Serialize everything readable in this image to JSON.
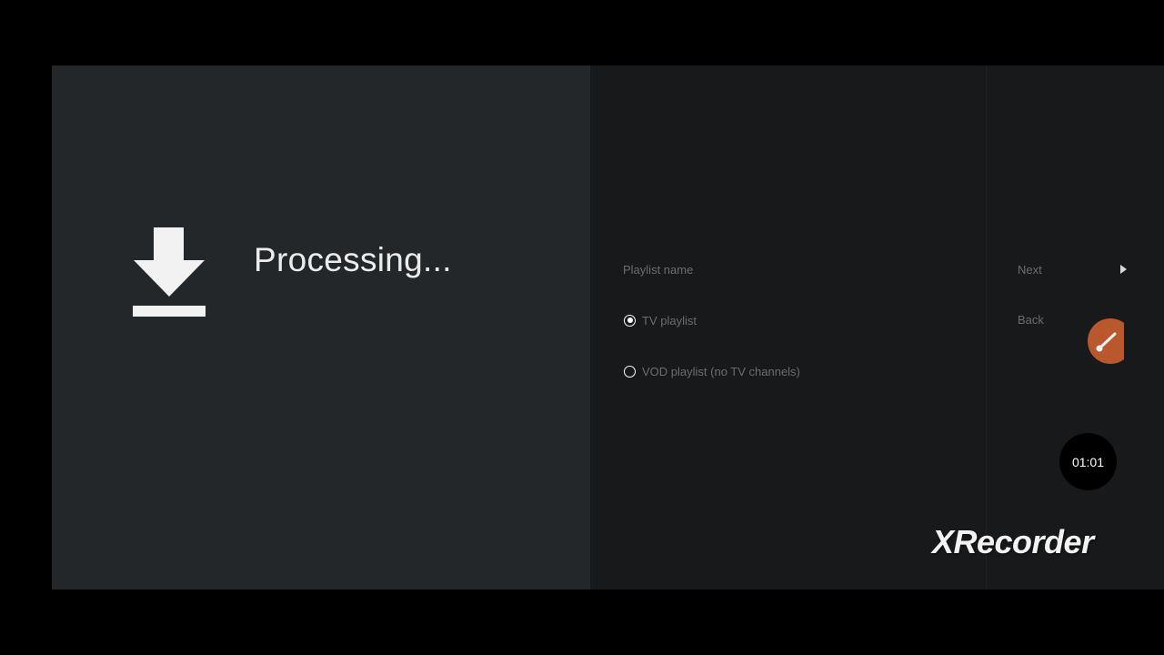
{
  "progress": {
    "icon": "download-icon",
    "status_text": "Processing..."
  },
  "form": {
    "playlist_name_label": "Playlist name",
    "options": [
      {
        "label": "TV playlist",
        "selected": true
      },
      {
        "label": "VOD playlist (no TV channels)",
        "selected": false
      }
    ]
  },
  "actions": {
    "next_label": "Next",
    "back_label": "Back"
  },
  "recorder": {
    "timer": "01:01",
    "watermark": "XRecorder",
    "bubble_icon": "brush-icon",
    "bubble_color": "#b9582e"
  },
  "colors": {
    "left_panel": "#23272a",
    "right_panel": "#17191b",
    "muted_text": "#6a6e72"
  }
}
